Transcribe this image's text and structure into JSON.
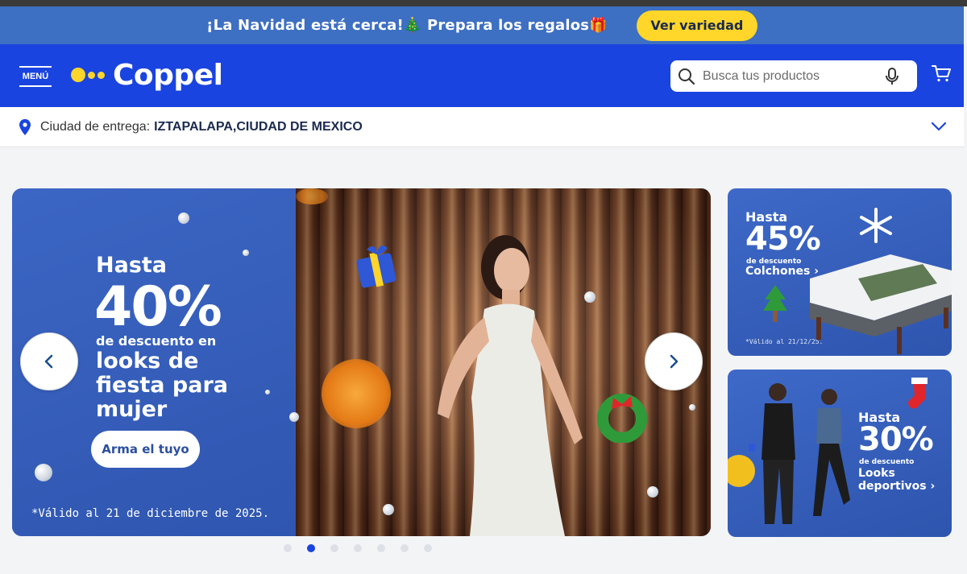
{
  "promo": {
    "text": "¡La Navidad está cerca!🎄 Prepara los regalos🎁",
    "button": "Ver variedad"
  },
  "header": {
    "menu_label": "MENÚ",
    "logo_text": "Coppel",
    "search_placeholder": "Busca tus productos"
  },
  "delivery": {
    "label": "Ciudad de entrega:",
    "city": "IZTAPALAPA,CIUDAD DE MEXICO"
  },
  "hero": {
    "hasta": "Hasta",
    "percent": "40%",
    "desc": "de descuento en",
    "headline": "looks de fiesta para mujer",
    "cta": "Arma el tuyo",
    "legal": "*Válido al 21 de diciembre de 2025."
  },
  "carousel": {
    "slide_count": 7,
    "active_index": 1
  },
  "cards": [
    {
      "hasta": "Hasta",
      "percent": "45%",
      "desc": "de descuento",
      "category": "Colchones ›",
      "legal": "*Válido al 21/12/25."
    },
    {
      "hasta": "Hasta",
      "percent": "30%",
      "desc": "de descuento",
      "category_line1": "Looks",
      "category_line2": "deportivos ›"
    }
  ],
  "colors": {
    "brand_blue": "#1a44df",
    "promo_blue": "#3d6fc2",
    "accent_yellow": "#ffd629"
  }
}
